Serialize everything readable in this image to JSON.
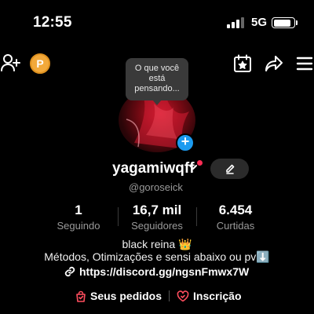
{
  "status_bar": {
    "time": "12:55",
    "network": "5G",
    "signal_bars": 4,
    "signal_level": 3,
    "battery_level": 0.85
  },
  "nav": {
    "coin_label": "P"
  },
  "profile": {
    "note_bubble": [
      "O que você",
      "está",
      "pensando..."
    ],
    "avatar_add": "+",
    "username": "yagamiwqff",
    "handle": "@goroseick"
  },
  "stats": [
    {
      "value": "1",
      "label": "Seguindo"
    },
    {
      "value": "16,7 mil",
      "label": "Seguidores"
    },
    {
      "value": "6.454",
      "label": "Curtidas"
    }
  ],
  "bio": {
    "line1": "black reina 👑",
    "line2": "Métodos, Otimizações e sensi abaixo ou pv⬇️",
    "link": "https://discord.gg/ngsnFmwx7W"
  },
  "actions": {
    "orders": "Seus pedidos",
    "subscription": "Inscrição"
  },
  "colors": {
    "background": "#000000",
    "accent_blue": "#1c9bf0",
    "coin": "#f2a93b",
    "notification_dot": "#ff2d55",
    "subscription_icon": "#ff4d5e"
  }
}
